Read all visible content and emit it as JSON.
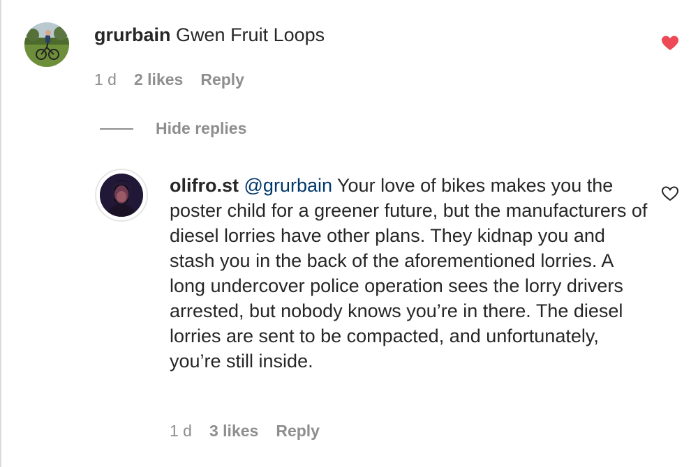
{
  "comments": [
    {
      "username": "grurbain",
      "text": "Gwen Fruit Loops",
      "time": "1 d",
      "likes": "2 likes",
      "reply_label": "Reply",
      "liked": true,
      "avatar_icon": "cyclist-photo-avatar",
      "heart_icon": "heart-filled-icon"
    }
  ],
  "replies_toggle": {
    "label": "Hide replies"
  },
  "replies": [
    {
      "username": "olifro.st",
      "mention": "@grurbain",
      "text": "Your love of bikes makes you the poster child for a greener future, but the manufacturers of diesel lorries have other plans. They kidnap you and stash you in the back of the aforementioned lorries. A long undercover police operation sees the lorry drivers arrested, but nobody knows you’re in there. The diesel lorries are sent to be compacted, and unfortunately, you’re still inside.",
      "time": "1 d",
      "likes": "3 likes",
      "reply_label": "Reply",
      "liked": false,
      "avatar_icon": "dark-portrait-avatar",
      "heart_icon": "heart-outline-icon"
    }
  ],
  "colors": {
    "liked_heart": "#ed4956",
    "meta_text": "#8e8e8e",
    "mention": "#00376b",
    "text": "#262626"
  }
}
